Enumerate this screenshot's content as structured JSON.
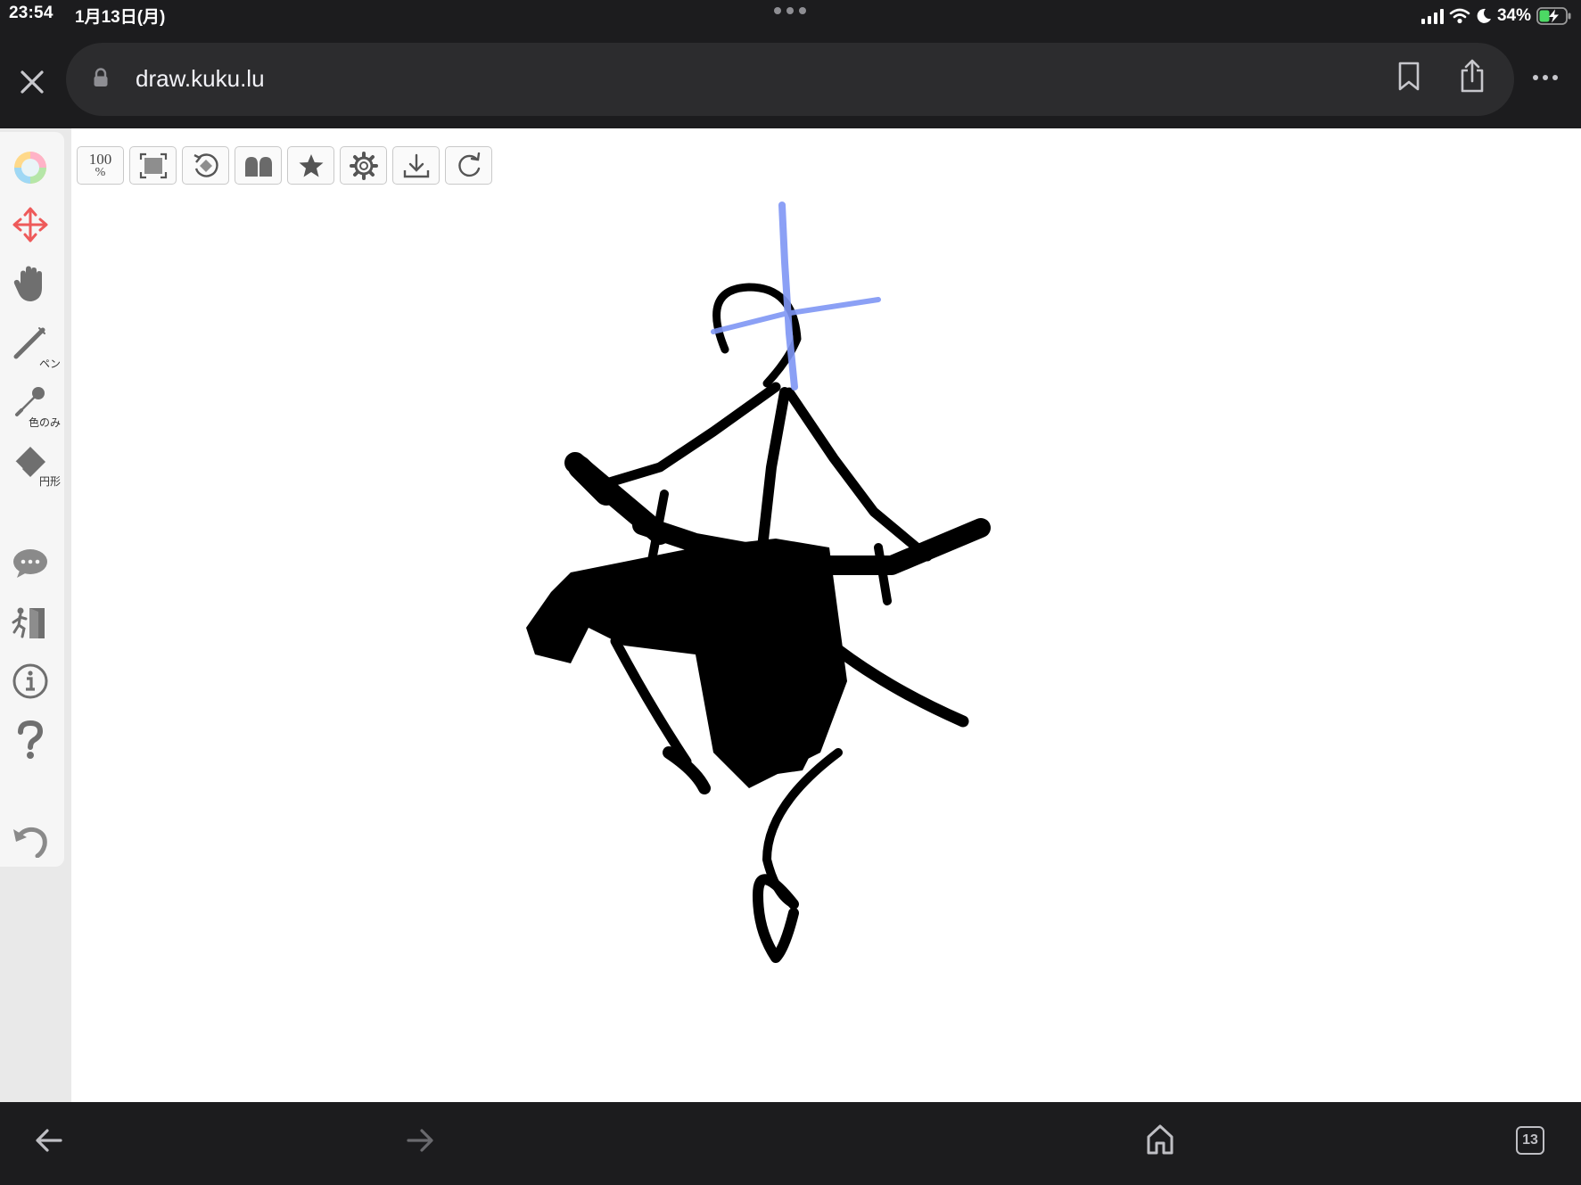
{
  "status_bar": {
    "time": "23:54",
    "date": "1月13日(月)",
    "battery_percent": "34%",
    "icons": [
      "signal-icon",
      "wifi-icon",
      "moon-icon",
      "battery-charging-icon"
    ]
  },
  "browser": {
    "url": "draw.kuku.lu",
    "buttons": [
      "close-icon",
      "lock-icon",
      "bookmark-icon",
      "share-icon",
      "more-icon"
    ]
  },
  "sidebar": {
    "tools": [
      {
        "name": "color-wheel",
        "icon": "color-wheel-icon",
        "label": ""
      },
      {
        "name": "move",
        "icon": "move-arrows-icon",
        "label": ""
      },
      {
        "name": "hand",
        "icon": "hand-icon",
        "label": ""
      },
      {
        "name": "pen",
        "icon": "pen-icon",
        "label": "ペン"
      },
      {
        "name": "eyedropper",
        "icon": "eyedropper-icon",
        "label": "色のみ"
      },
      {
        "name": "eraser",
        "icon": "eraser-icon",
        "label": "円形"
      },
      {
        "name": "chat",
        "icon": "chat-bubble-icon",
        "label": ""
      },
      {
        "name": "exit",
        "icon": "exit-door-icon",
        "label": ""
      },
      {
        "name": "info",
        "icon": "info-icon",
        "label": ""
      },
      {
        "name": "help",
        "icon": "question-icon",
        "label": ""
      },
      {
        "name": "undo",
        "icon": "undo-icon",
        "label": ""
      }
    ]
  },
  "toolbar": {
    "zoom_value": "100",
    "zoom_unit": "%",
    "buttons": [
      "zoom-100-button",
      "fit-screen-icon",
      "rotate-icon",
      "layers-icon",
      "favorite-star-icon",
      "settings-gear-icon",
      "download-icon",
      "reload-icon"
    ]
  },
  "bottom_bar": {
    "tab_count": "13",
    "buttons": [
      "back-arrow-icon",
      "forward-arrow-icon",
      "home-icon",
      "tabs-icon"
    ]
  },
  "colors": {
    "chrome_dark": "#1c1c1e",
    "address_pill": "#2c2c2e",
    "ink": "#000000",
    "guide_blue": "#7f96f5",
    "move_tool_red": "#ee5a5a",
    "battery_green": "#4cd964"
  }
}
